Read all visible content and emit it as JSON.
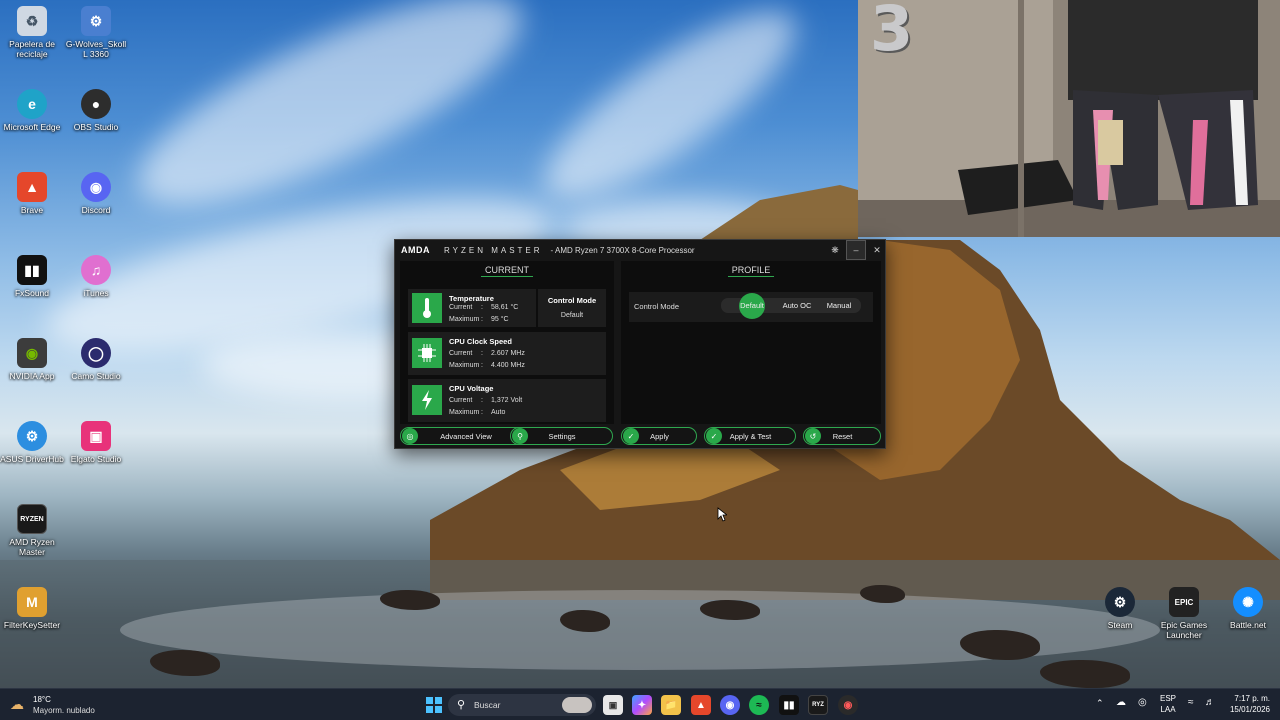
{
  "desktop": {
    "icons": [
      {
        "label": "Papelera de reciclaje",
        "icon": "recycle-bin-icon",
        "color": "#cfd8e3"
      },
      {
        "label": "G-Wolves_Skoll L 3360",
        "icon": "mouse-app-icon",
        "color": "#4a7fd0"
      },
      {
        "label": "Microsoft Edge",
        "icon": "edge-icon",
        "color": "#1fa3c8"
      },
      {
        "label": "OBS Studio",
        "icon": "obs-icon",
        "color": "#2d2d2d"
      },
      {
        "label": "Brave",
        "icon": "brave-icon",
        "color": "#e5472b"
      },
      {
        "label": "Discord",
        "icon": "discord-icon",
        "color": "#5865f2"
      },
      {
        "label": "FxSound",
        "icon": "fxsound-icon",
        "color": "#111111"
      },
      {
        "label": "iTunes",
        "icon": "itunes-icon",
        "color": "#e06fd0"
      },
      {
        "label": "NVIDIA App",
        "icon": "nvidia-icon",
        "color": "#3c3c3c"
      },
      {
        "label": "Camo Studio",
        "icon": "camo-icon",
        "color": "#2b2b6e"
      },
      {
        "label": "ASUS DriverHub",
        "icon": "asus-gear-icon",
        "color": "#2c8ee0"
      },
      {
        "label": "Elgato Studio",
        "icon": "elgato-icon",
        "color": "#e8327a"
      },
      {
        "label": "AMD Ryzen Master",
        "icon": "ryzen-master-icon",
        "color": "#1a1a1a"
      },
      {
        "label": "FilterKeySetter",
        "icon": "filterkey-icon",
        "color": "#e0a030"
      },
      {
        "label": "Steam",
        "icon": "steam-icon",
        "color": "#1b2838"
      },
      {
        "label": "Epic Games Launcher",
        "icon": "epic-games-icon",
        "color": "#222222"
      },
      {
        "label": "Battle.net",
        "icon": "battlenet-icon",
        "color": "#148eff"
      }
    ]
  },
  "ryzen_master": {
    "brand": "AMDA",
    "app_name": "RYZEN MASTER",
    "processor": "-  AMD Ryzen 7 3700X 8-Core Processor",
    "current": {
      "heading": "CURRENT",
      "temperature": {
        "title": "Temperature",
        "current_label": "Current",
        "current_value": "58,61 °C",
        "max_label": "Maximum",
        "max_value": "95 °C"
      },
      "control_mode": {
        "title": "Control Mode",
        "value": "Default"
      },
      "clock": {
        "title": "CPU Clock Speed",
        "current_label": "Current",
        "current_value": "2.607  MHz",
        "max_label": "Maximum",
        "max_value": "4.400  MHz"
      },
      "voltage": {
        "title": "CPU Voltage",
        "current_label": "Current",
        "current_value": "1,372  Volt",
        "max_label": "Maximum",
        "max_value": "Auto"
      }
    },
    "profile": {
      "heading": "PROFILE",
      "control_mode_label": "Control Mode",
      "options": [
        "Default",
        "Auto OC",
        "Manual"
      ],
      "selected": "Default"
    },
    "buttons": {
      "advanced_view": "Advanced View",
      "settings": "Settings",
      "apply": "Apply",
      "apply_test": "Apply & Test",
      "reset": "Reset"
    },
    "accent": "#2aa84a"
  },
  "taskbar": {
    "weather_temp": "18°C",
    "weather_desc": "Mayorm. nublado",
    "search_placeholder": "Buscar",
    "lang_top": "ESP",
    "lang_bottom": "LAA",
    "time": "7:17 p. m.",
    "date": "15/01/2026"
  },
  "webcam": {
    "balloon_digit": "3"
  }
}
